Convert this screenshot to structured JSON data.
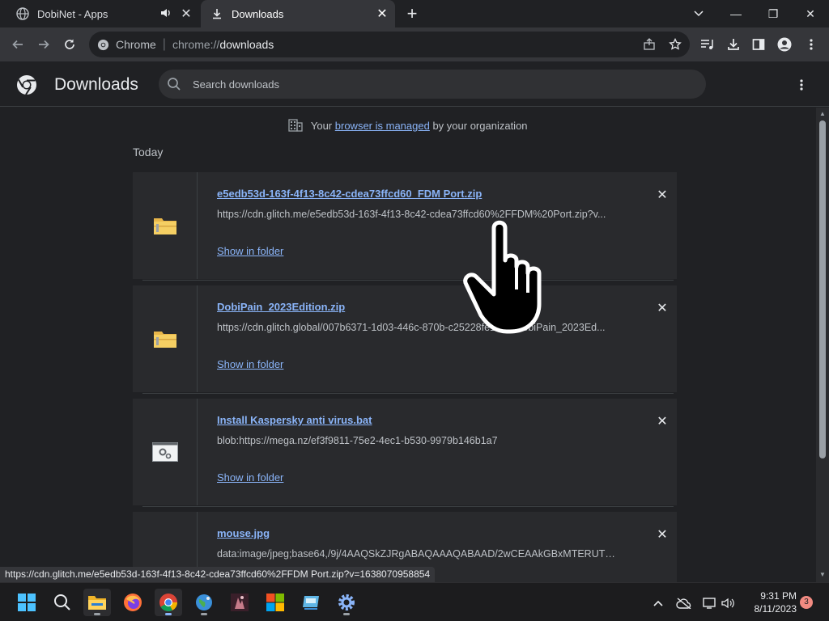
{
  "window": {
    "tabs": [
      {
        "title": "DobiNet - Apps",
        "audio": true
      },
      {
        "title": "Downloads",
        "active": true
      }
    ],
    "new_tab_label": "+",
    "minimize": "—",
    "restore": "❐",
    "close": "✕"
  },
  "toolbar": {
    "site_label": "Chrome",
    "url_scheme": "chrome://",
    "url_host": "downloads"
  },
  "page": {
    "title": "Downloads",
    "search_placeholder": "Search downloads",
    "managed_prefix": "Your",
    "managed_link": "browser is managed",
    "managed_suffix": "by your organization",
    "day_label": "Today",
    "show_in_folder": "Show in folder",
    "downloads": [
      {
        "name": "e5edb53d-163f-4f13-8c42-cdea73ffcd60_FDM Port.zip",
        "url": "https://cdn.glitch.me/e5edb53d-163f-4f13-8c42-cdea73ffcd60%2FFDM%20Port.zip?v...",
        "icon": "zip-folder-icon"
      },
      {
        "name": "DobiPain_2023Edition.zip",
        "url": "https://cdn.glitch.global/007b6371-1d03-446c-870b-c25228fe1a9b/DobiPain_2023Ed...",
        "icon": "zip-folder-icon"
      },
      {
        "name": "Install Kaspersky anti virus.bat",
        "url": "blob:https://mega.nz/ef3f9811-75e2-4ec1-b530-9979b146b1a7",
        "icon": "batch-file-icon"
      },
      {
        "name": "mouse.jpg",
        "url": "data:image/jpeg;base64,/9j/4AAQSkZJRgABAQAAAQABAAD/2wCEAAkGBxMTERUTEx...",
        "icon": "image-file-icon"
      }
    ]
  },
  "status_bar": {
    "url": "https://cdn.glitch.me/e5edb53d-163f-4f13-8c42-cdea73ffcd60%2FFDM Port.zip?v=1638070958854"
  },
  "taskbar": {
    "time": "9:31 PM",
    "date": "8/11/2023",
    "notification_count": "3"
  },
  "colors": {
    "link": "#8ab4f8",
    "background": "#202124",
    "card": "#292a2d"
  }
}
